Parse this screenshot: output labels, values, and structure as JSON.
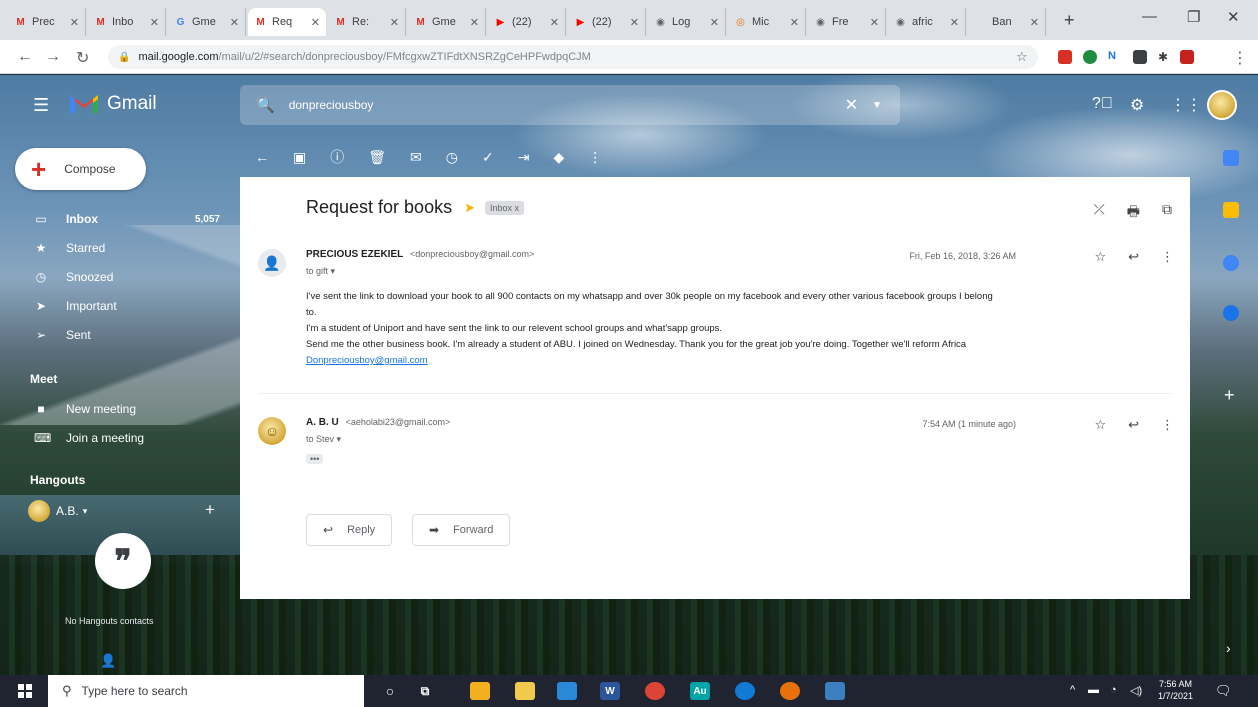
{
  "browser": {
    "tabs": [
      {
        "label": "Prec",
        "favicon": "M",
        "color": "#d93025"
      },
      {
        "label": "Inbo",
        "favicon": "M",
        "color": "#d93025"
      },
      {
        "label": "Gme",
        "favicon": "G",
        "color": "#4285f4"
      },
      {
        "label": "Req",
        "favicon": "M",
        "color": "#d93025",
        "active": true
      },
      {
        "label": "Re:",
        "favicon": "M",
        "color": "#d93025"
      },
      {
        "label": "Gme",
        "favicon": "M",
        "color": "#d93025"
      },
      {
        "label": "(22)",
        "favicon": "▶",
        "color": "#ff0000"
      },
      {
        "label": "(22)",
        "favicon": "▶",
        "color": "#ff0000"
      },
      {
        "label": "Log",
        "favicon": "◉",
        "color": "#5f6368"
      },
      {
        "label": "Mic",
        "favicon": "◎",
        "color": "#e8710a"
      },
      {
        "label": "Fre",
        "favicon": "◉",
        "color": "#5f6368"
      },
      {
        "label": "afric",
        "favicon": "◉",
        "color": "#5f6368"
      },
      {
        "label": "Ban",
        "favicon": "",
        "color": "#5f6368"
      }
    ],
    "url_host": "mail.google.com",
    "url_path": "/mail/u/2/#search/donpreciousboy/FMfcgxwZTIFdtXNSRZgCeHPFwdpqCJM"
  },
  "gmail": {
    "app_name": "Gmail",
    "search_value": "donpreciousboy",
    "compose_label": "Compose",
    "nav": [
      {
        "label": "Inbox",
        "icon": "inbox-icon",
        "count": "5,057",
        "active": true
      },
      {
        "label": "Starred",
        "icon": "star-icon"
      },
      {
        "label": "Snoozed",
        "icon": "clock-icon"
      },
      {
        "label": "Important",
        "icon": "important-icon"
      },
      {
        "label": "Sent",
        "icon": "send-icon"
      }
    ],
    "meet_title": "Meet",
    "meet_items": [
      {
        "label": "New meeting",
        "icon": "video-icon"
      },
      {
        "label": "Join a meeting",
        "icon": "keyboard-icon"
      }
    ],
    "hangouts_title": "Hangouts",
    "hangouts_user": "A.B.",
    "no_contacts": "No Hangouts contacts",
    "subject": "Request for books",
    "label": "Inbox x",
    "messages": [
      {
        "sender": "PRECIOUS EZEKIEL",
        "email": "<donpreciousboy@gmail.com>",
        "to": "to gift",
        "date": "Fri, Feb 16, 2018, 3:26 AM",
        "body": [
          "I've sent the link to download your book to all 900 contacts on my whatsapp and over 30k people on my facebook and every other various facebook groups I belong",
          "to.",
          "I'm a student of Uniport and have sent the link to our relevent school groups and what'sapp groups.",
          "Send me the other business book. I'm already a student of ABU. I joined on Wednesday. Thank you for the great job you're doing. Together we'll reform Africa"
        ],
        "link": "Donpreciousboy@gmail.com"
      },
      {
        "sender": "A. B. U",
        "email": "<aeholabi23@gmail.com>",
        "to": "to Stev",
        "date": "7:54 AM (1 minute ago)",
        "ellipsis": "•••"
      }
    ],
    "reply_label": "Reply",
    "forward_label": "Forward"
  },
  "taskbar": {
    "search_placeholder": "Type here to search",
    "time": "7:56 AM",
    "date": "1/7/2021"
  }
}
